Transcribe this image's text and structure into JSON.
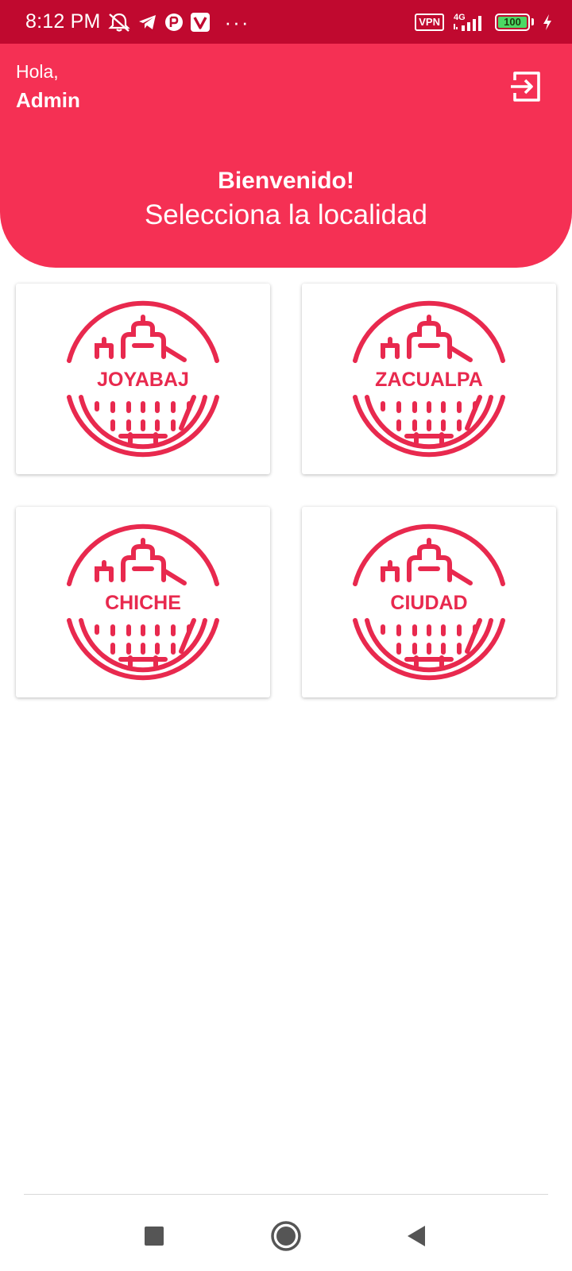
{
  "status_bar": {
    "time": "8:12 PM",
    "icons": [
      "alarm-off-icon",
      "telegram-icon",
      "app-r-icon",
      "app-v-icon"
    ],
    "more": "···",
    "vpn": "VPN",
    "network": "4G",
    "battery": "100",
    "battery_level": 1.0,
    "battery_color": "#4cd964"
  },
  "header": {
    "greeting": "Hola,",
    "username": "Admin",
    "welcome": "Bienvenido!",
    "subtitle": "Selecciona la localidad",
    "logout_icon": "logout-icon",
    "color": "#f53054"
  },
  "localities": [
    {
      "label": "JOYABAJ",
      "icon": "church-badge-icon"
    },
    {
      "label": "ZACUALPA",
      "icon": "church-badge-icon"
    },
    {
      "label": "CHICHE",
      "icon": "church-badge-icon"
    },
    {
      "label": "CIUDAD",
      "icon": "church-badge-icon"
    }
  ],
  "nav": {
    "recent_icon": "square-icon",
    "home_icon": "circle-icon",
    "back_icon": "triangle-back-icon"
  },
  "colors": {
    "status_bar": "#c0092f",
    "accent": "#e8294e"
  }
}
